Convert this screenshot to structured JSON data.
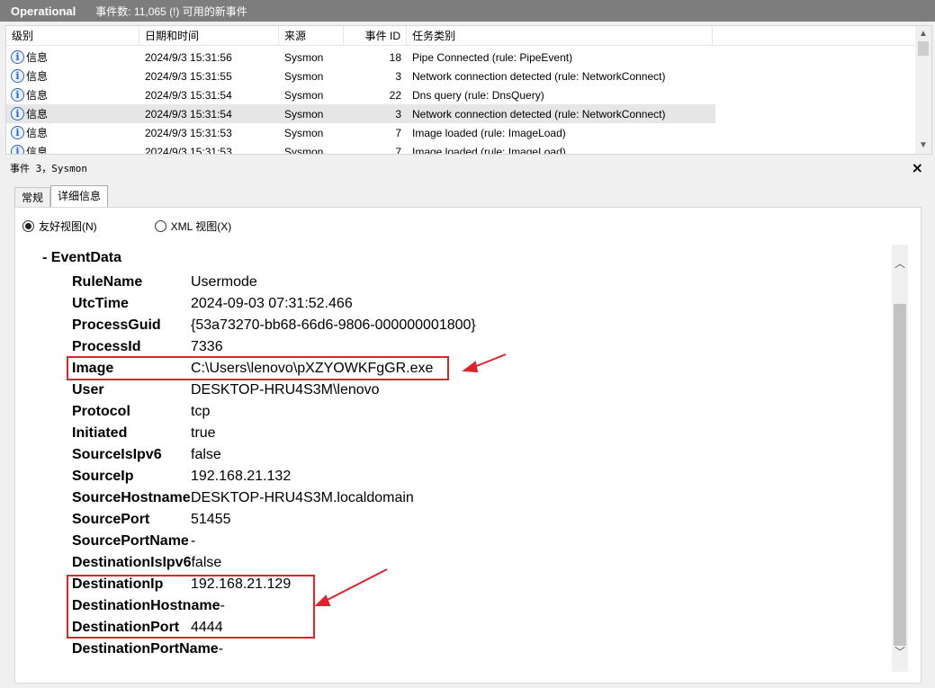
{
  "header": {
    "title": "Operational",
    "count_text": "事件数: 11,065 (!) 可用的新事件"
  },
  "columns": [
    "级别",
    "日期和时间",
    "来源",
    "事件 ID",
    "任务类别"
  ],
  "rows": [
    {
      "level": "信息",
      "datetime": "2024/9/3 15:31:56",
      "source": "Sysmon",
      "id": "18",
      "task": "Pipe Connected (rule: PipeEvent)"
    },
    {
      "level": "信息",
      "datetime": "2024/9/3 15:31:55",
      "source": "Sysmon",
      "id": "3",
      "task": "Network connection detected (rule: NetworkConnect)"
    },
    {
      "level": "信息",
      "datetime": "2024/9/3 15:31:54",
      "source": "Sysmon",
      "id": "22",
      "task": "Dns query (rule: DnsQuery)"
    },
    {
      "level": "信息",
      "datetime": "2024/9/3 15:31:54",
      "source": "Sysmon",
      "id": "3",
      "task": "Network connection detected (rule: NetworkConnect)"
    },
    {
      "level": "信息",
      "datetime": "2024/9/3 15:31:53",
      "source": "Sysmon",
      "id": "7",
      "task": "Image loaded (rule: ImageLoad)"
    },
    {
      "level": "信息",
      "datetime": "2024/9/3 15:31:53",
      "source": "Sysmon",
      "id": "7",
      "task": "Image loaded (rule: ImageLoad)"
    }
  ],
  "selected_row": 3,
  "detail": {
    "title": "事件 3，Sysmon",
    "tabs": [
      "常规",
      "详细信息"
    ],
    "active_tab": 1,
    "radio_friendly": "友好视图(N)",
    "radio_xml": "XML 视图(X)",
    "section_title": "-  EventData",
    "fields": [
      {
        "k": "RuleName",
        "v": "Usermode"
      },
      {
        "k": "UtcTime",
        "v": "2024-09-03 07:31:52.466"
      },
      {
        "k": "ProcessGuid",
        "v": "{53a73270-bb68-66d6-9806-000000001800}"
      },
      {
        "k": "ProcessId",
        "v": "7336"
      },
      {
        "k": "Image",
        "v": "C:\\Users\\lenovo\\pXZYOWKFgGR.exe"
      },
      {
        "k": "User",
        "v": "DESKTOP-HRU4S3M\\lenovo"
      },
      {
        "k": "Protocol",
        "v": "tcp"
      },
      {
        "k": "Initiated",
        "v": "true"
      },
      {
        "k": "SourceIsIpv6",
        "v": "false"
      },
      {
        "k": "SourceIp",
        "v": "192.168.21.132"
      },
      {
        "k": "SourceHostname",
        "v": "DESKTOP-HRU4S3M.localdomain"
      },
      {
        "k": "SourcePort",
        "v": "51455"
      },
      {
        "k": "SourcePortName",
        "v": "-"
      },
      {
        "k": "DestinationIsIpv6",
        "v": "false"
      },
      {
        "k": "DestinationIp",
        "v": "192.168.21.129"
      },
      {
        "k": "DestinationHostname",
        "v": "-"
      },
      {
        "k": "DestinationPort",
        "v": "4444"
      },
      {
        "k": "DestinationPortName",
        "v": "-"
      }
    ]
  },
  "annotation_color": "#e0222a"
}
